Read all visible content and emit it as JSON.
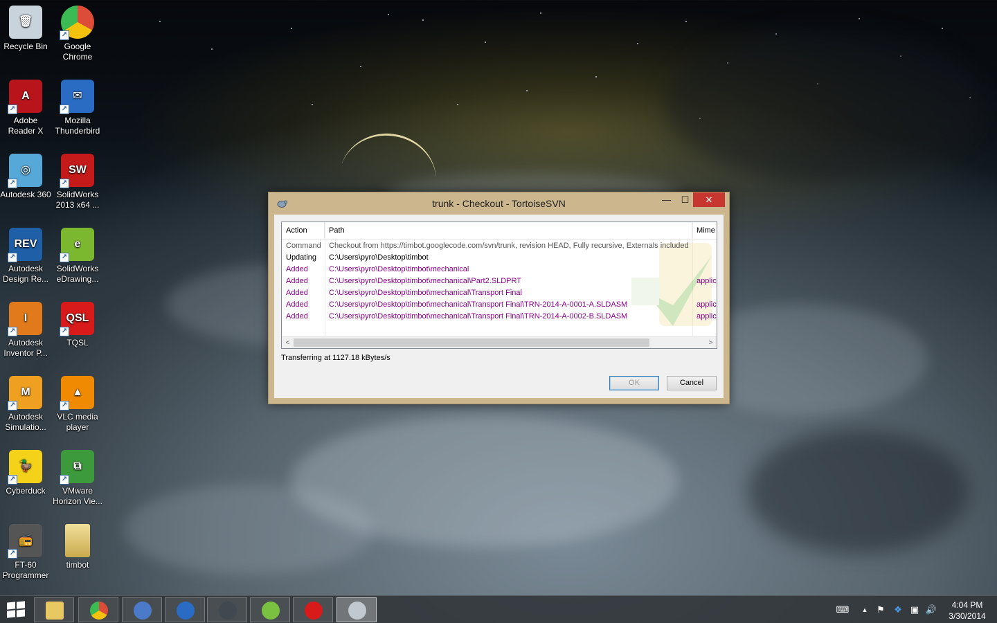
{
  "desktop": {
    "icons": [
      {
        "label": "Recycle Bin",
        "glyph": "🗑",
        "color": "#c9d3dc",
        "shortcut": false
      },
      {
        "label": "Google Chrome",
        "glyph": "",
        "color": "#dd4b39",
        "shortcut": true
      },
      {
        "label": "Adobe Reader X",
        "glyph": "A",
        "color": "#b8141b",
        "shortcut": true
      },
      {
        "label": "Mozilla Thunderbird",
        "glyph": "✉",
        "color": "#2a6cc4",
        "shortcut": true
      },
      {
        "label": "Autodesk 360",
        "glyph": "◎",
        "color": "#55a8d8",
        "shortcut": true
      },
      {
        "label": "SolidWorks 2013 x64 ...",
        "glyph": "SW",
        "color": "#c41a1a",
        "shortcut": true
      },
      {
        "label": "Autodesk Design Re...",
        "glyph": "REV",
        "color": "#1f5fa8",
        "shortcut": true
      },
      {
        "label": "SolidWorks eDrawing...",
        "glyph": "e",
        "color": "#7cb82f",
        "shortcut": true
      },
      {
        "label": "Autodesk Inventor P...",
        "glyph": "I",
        "color": "#e07a1a",
        "shortcut": true
      },
      {
        "label": "TQSL",
        "glyph": "QSL",
        "color": "#d81a1a",
        "shortcut": true
      },
      {
        "label": "Autodesk Simulatio...",
        "glyph": "M",
        "color": "#f0a020",
        "shortcut": true
      },
      {
        "label": "VLC media player",
        "glyph": "▲",
        "color": "#f08a00",
        "shortcut": true
      },
      {
        "label": "Cyberduck",
        "glyph": "🦆",
        "color": "#f5d21a",
        "shortcut": true
      },
      {
        "label": "VMware Horizon Vie...",
        "glyph": "⧉",
        "color": "#3c9a3c",
        "shortcut": true
      },
      {
        "label": "FT-60 Programmer",
        "glyph": "📻",
        "color": "#555555",
        "shortcut": true
      },
      {
        "label": "timbot",
        "glyph": "",
        "color": "#e8d58a",
        "shortcut": false
      }
    ]
  },
  "dialog": {
    "title": "trunk - Checkout - TortoiseSVN",
    "controls": {
      "minimize": "—",
      "maximize": "☐",
      "close": "✕"
    },
    "columns": [
      "Action",
      "Path",
      "Mime t"
    ],
    "rows": [
      {
        "action": "Command",
        "path": "Checkout from https://timbot.googlecode.com/svn/trunk, revision HEAD, Fully recursive, Externals included",
        "mime": "",
        "kind": "cmd"
      },
      {
        "action": "Updating",
        "path": "C:\\Users\\pyro\\Desktop\\timbot",
        "mime": "",
        "kind": "upd"
      },
      {
        "action": "Added",
        "path": "C:\\Users\\pyro\\Desktop\\timbot\\mechanical",
        "mime": "",
        "kind": "add"
      },
      {
        "action": "Added",
        "path": "C:\\Users\\pyro\\Desktop\\timbot\\mechanical\\Part2.SLDPRT",
        "mime": "applica",
        "kind": "add"
      },
      {
        "action": "Added",
        "path": "C:\\Users\\pyro\\Desktop\\timbot\\mechanical\\Transport Final",
        "mime": "",
        "kind": "add"
      },
      {
        "action": "Added",
        "path": "C:\\Users\\pyro\\Desktop\\timbot\\mechanical\\Transport Final\\TRN-2014-A-0001-A.SLDASM",
        "mime": "applica",
        "kind": "add"
      },
      {
        "action": "Added",
        "path": "C:\\Users\\pyro\\Desktop\\timbot\\mechanical\\Transport Final\\TRN-2014-A-0002-B.SLDASM",
        "mime": "applica",
        "kind": "add"
      }
    ],
    "status": "Transferring at 1127.18 kBytes/s",
    "ok_label": "OK",
    "cancel_label": "Cancel",
    "scroll_left": "<",
    "scroll_right": ">"
  },
  "taskbar": {
    "apps": [
      {
        "name": "file-explorer",
        "color": "#e8c860",
        "active": false
      },
      {
        "name": "google-chrome",
        "color": "#dd4b39",
        "active": false
      },
      {
        "name": "network-tool",
        "color": "#4a7ac8",
        "active": false
      },
      {
        "name": "thunderbird",
        "color": "#2a6cc4",
        "active": false
      },
      {
        "name": "steam",
        "color": "#404850",
        "active": false
      },
      {
        "name": "spotify",
        "color": "#7ac142",
        "active": false
      },
      {
        "name": "tqsl",
        "color": "#d81a1a",
        "active": false
      },
      {
        "name": "tortoisesvn",
        "color": "#c0c8d0",
        "active": true
      }
    ],
    "tray": {
      "keyboard": "⌨",
      "chevron": "▲",
      "flag": "⚑",
      "dropbox": "❖",
      "network": "▣",
      "volume": "🔊"
    },
    "time": "4:04 PM",
    "date": "3/30/2014"
  }
}
